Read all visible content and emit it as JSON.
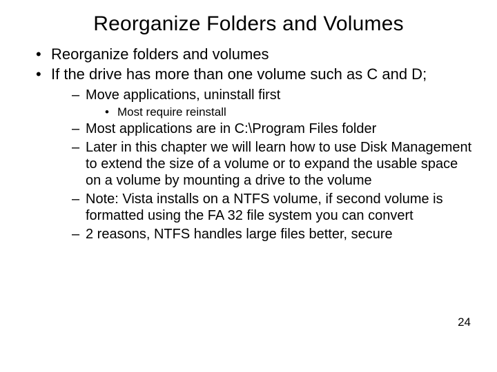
{
  "title": "Reorganize Folders and Volumes",
  "bullets": {
    "b1": "Reorganize folders and volumes",
    "b2": "If  the drive has more than one volume such as C and D;",
    "sub": {
      "s1": "Move applications, uninstall first",
      "s1a": "Most require reinstall",
      "s2": "Most applications are in C:\\Program Files folder",
      "s3": "Later in this chapter  we will learn how to use Disk Management to extend the size of a volume or to expand the usable space on a volume by mounting a drive to the volume",
      "s4": "Note: Vista installs on a NTFS volume, if second volume  is formatted using the FA 32 file system you can convert",
      "s5": "2 reasons, NTFS handles large files better, secure"
    }
  },
  "page_number": "24"
}
